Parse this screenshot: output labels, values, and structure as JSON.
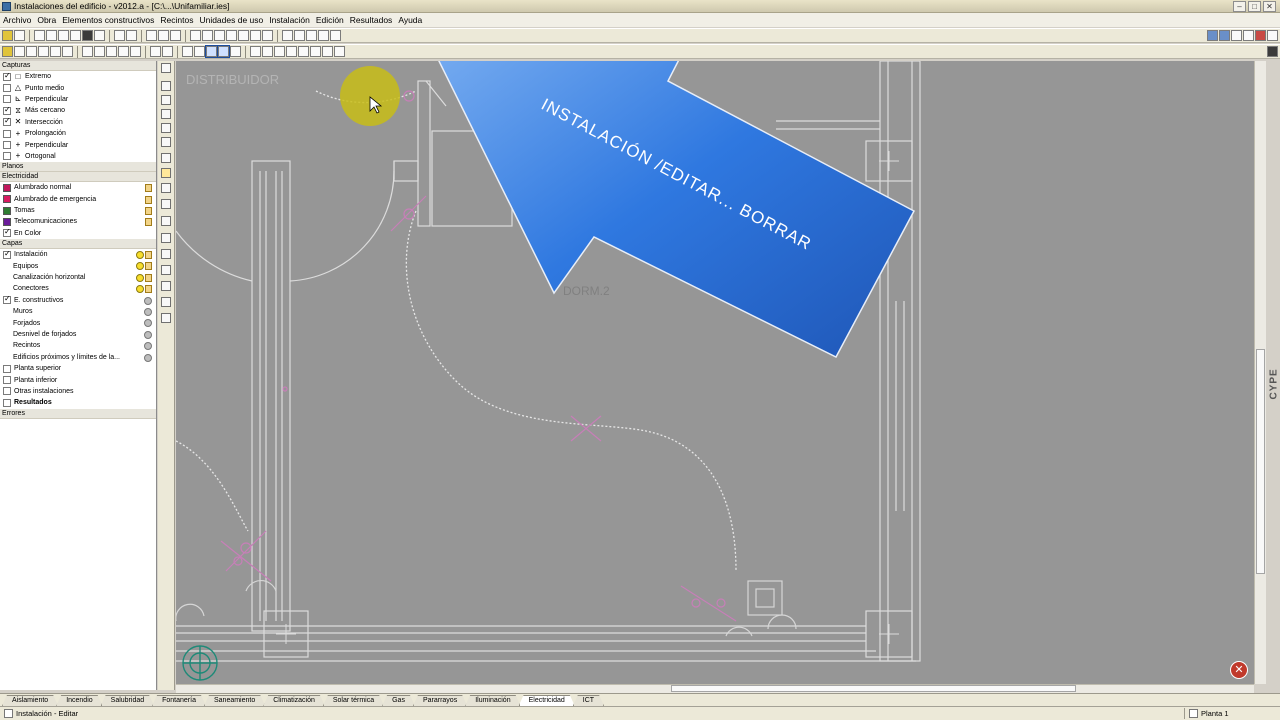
{
  "window": {
    "title": "Instalaciones del edificio - v2012.a - [C:\\...\\Unifamiliar.ies]"
  },
  "menu": [
    "Archivo",
    "Obra",
    "Elementos constructivos",
    "Recintos",
    "Unidades de uso",
    "Instalación",
    "Edición",
    "Resultados",
    "Ayuda"
  ],
  "left_panel": {
    "capturas_header": "Capturas",
    "capturas": [
      {
        "label": "Extremo",
        "checked": true,
        "symbol": "□"
      },
      {
        "label": "Punto medio",
        "checked": false,
        "symbol": "△"
      },
      {
        "label": "Perpendicular",
        "checked": false,
        "symbol": "⊾"
      },
      {
        "label": "Más cercano",
        "checked": true,
        "symbol": "⧖"
      },
      {
        "label": "Intersección",
        "checked": true,
        "symbol": "✕"
      },
      {
        "label": "Prolongación",
        "checked": false,
        "symbol": "+"
      },
      {
        "label": "Perpendicular",
        "checked": false,
        "symbol": "+"
      },
      {
        "label": "Ortogonal",
        "checked": false,
        "symbol": "+"
      }
    ],
    "planos_header": "Planos",
    "electricidad_header": "Electricidad",
    "planos": [
      {
        "label": "Alumbrado normal",
        "color": "#c2185b"
      },
      {
        "label": "Alumbrado de emergencia",
        "color": "#d81b60"
      },
      {
        "label": "Tomas",
        "color": "#2e7d32"
      },
      {
        "label": "Telecomunicaciones",
        "color": "#6a1b9a"
      }
    ],
    "en_color": {
      "label": "En Color",
      "checked": true
    },
    "capas_header": "Capas",
    "capas": [
      {
        "label": "Instalación",
        "checked": true,
        "indent": false,
        "lamp": "on"
      },
      {
        "label": "Equipos",
        "checked": null,
        "indent": true,
        "lamp": "on"
      },
      {
        "label": "Canalización horizontal",
        "checked": null,
        "indent": true,
        "lamp": "on"
      },
      {
        "label": "Conectores",
        "checked": null,
        "indent": true,
        "lamp": "on"
      },
      {
        "label": "E. constructivos",
        "checked": true,
        "indent": false,
        "lamp": "off"
      },
      {
        "label": "Muros",
        "checked": null,
        "indent": true,
        "lamp": "off"
      },
      {
        "label": "Forjados",
        "checked": null,
        "indent": true,
        "lamp": "off"
      },
      {
        "label": "Desnivel de forjados",
        "checked": null,
        "indent": true,
        "lamp": "off"
      },
      {
        "label": "Recintos",
        "checked": null,
        "indent": true,
        "lamp": "off"
      },
      {
        "label": "Edificios próximos y límites de la...",
        "checked": null,
        "indent": true,
        "lamp": "off"
      },
      {
        "label": "Planta superior",
        "checked": false,
        "indent": false,
        "lamp": null
      },
      {
        "label": "Planta inferior",
        "checked": false,
        "indent": false,
        "lamp": null
      },
      {
        "label": "Otras instalaciones",
        "checked": false,
        "indent": false,
        "lamp": null
      }
    ],
    "resultados": "Resultados",
    "errores": "Errores"
  },
  "canvas": {
    "room_labels": [
      "DISTRIBUIDOR",
      "DORM.2"
    ],
    "annotation_text": "INSTALACIÓN /EDITAR... BORRAR",
    "annotation_color": "#2a6fd6",
    "cursor_highlight_color": "#c8bd17"
  },
  "right_tab": "CYPE",
  "tabs": [
    "Aislamiento",
    "Incendio",
    "Salubridad",
    "Fontanería",
    "Saneamiento",
    "Climatización",
    "Solar térmica",
    "Gas",
    "Pararrayos",
    "Iluminación",
    "Electricidad",
    "ICT"
  ],
  "active_tab": "Electricidad",
  "status": {
    "mode": "Instalación - Editar",
    "floor": "Planta 1"
  }
}
